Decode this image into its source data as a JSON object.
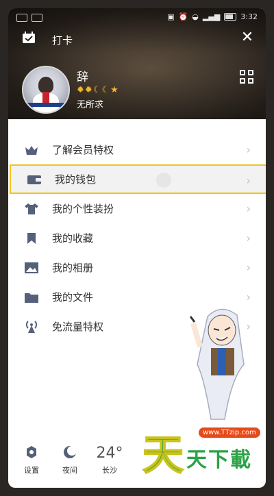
{
  "status": {
    "time": "3:32"
  },
  "header": {
    "checkin_label": "打卡",
    "nickname": "辞",
    "signature": "无所求"
  },
  "menu": {
    "items": [
      {
        "label": "了解会员特权",
        "icon": "vip-icon"
      },
      {
        "label": "我的钱包",
        "icon": "wallet-icon"
      },
      {
        "label": "我的个性装扮",
        "icon": "shirt-icon"
      },
      {
        "label": "我的收藏",
        "icon": "bookmark-icon"
      },
      {
        "label": "我的相册",
        "icon": "album-icon"
      },
      {
        "label": "我的文件",
        "icon": "folder-icon"
      },
      {
        "label": "免流量特权",
        "icon": "antenna-icon"
      }
    ]
  },
  "bottom": {
    "settings": "设置",
    "night": "夜间",
    "temperature": "24°",
    "city": "长沙"
  },
  "watermark": {
    "url": "www.TTzip.com",
    "text_big": "天",
    "text_small": "天下載"
  },
  "colors": {
    "highlight": "#f3c21c",
    "icon": "#55607a"
  }
}
